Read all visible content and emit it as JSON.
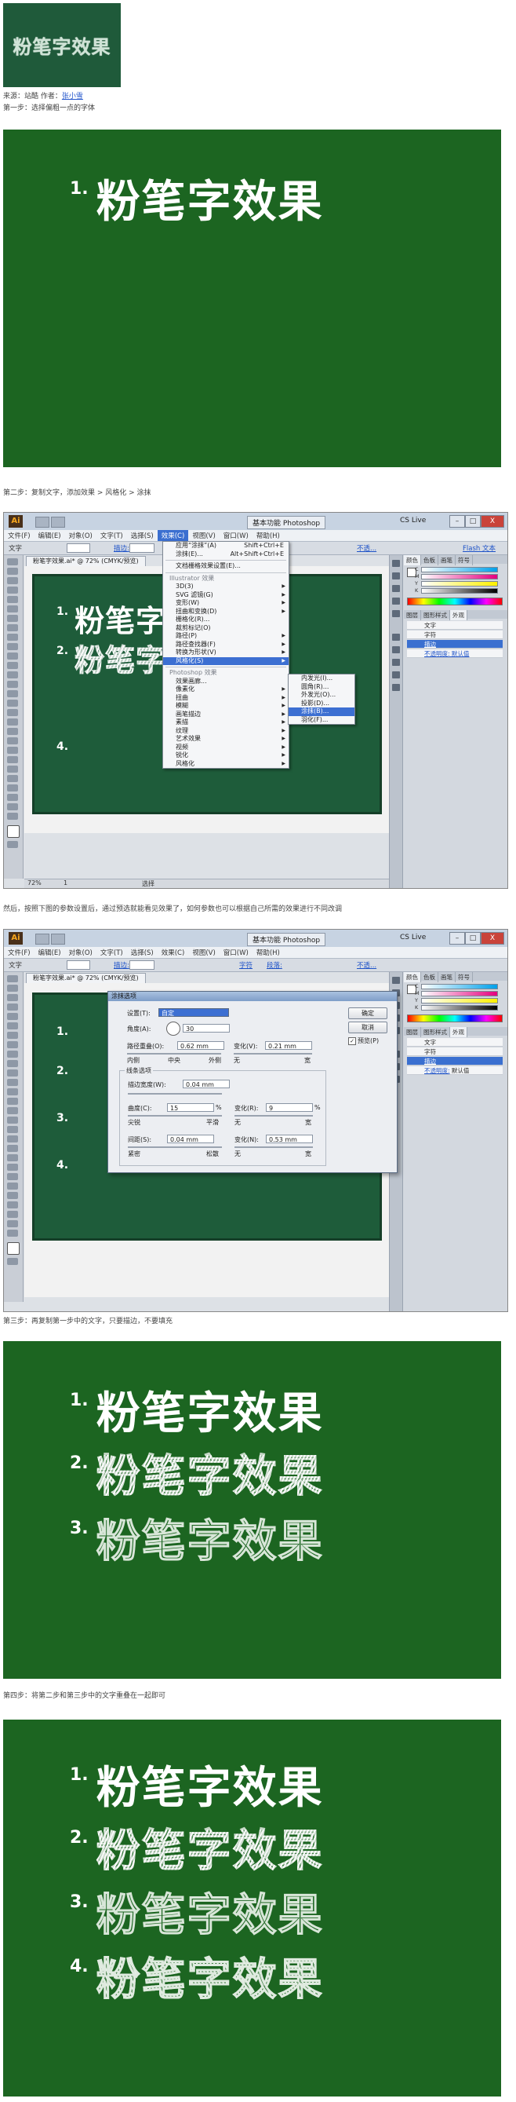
{
  "thumbnail": {
    "text": "粉笔字效果"
  },
  "source_line": {
    "prefix": "来源：站酷  作者：",
    "author": "张小雪"
  },
  "steps": [
    "第一步：选择偏粗一点的字体",
    "第二步：复制文字，添加效果 > 风格化 > 涂抹",
    "然后，按照下图的参数设置后，通过预选就能看见效果了，如何参数也可以根据自己所需的效果进行不同改调",
    "第三步：再复制第一步中的文字，只要描边，不要填充",
    "第四步：将第二步和第三步中的文字重叠在一起即可"
  ],
  "headline": "粉笔字效果",
  "numbers": [
    "1.",
    "2.",
    "3.",
    "4."
  ],
  "colors": {
    "board": "#1c6521",
    "artboard": "#1e5c3a",
    "accent": "#3c6fd2"
  },
  "illustrator": {
    "logo": "Ai",
    "workspace": "基本功能 Photoshop",
    "cs_live": "CS Live",
    "win_buttons": [
      "–",
      "□",
      "X"
    ],
    "menu": [
      "文件(F)",
      "编辑(E)",
      "对象(O)",
      "文字(T)",
      "选择(S)",
      "效果(C)",
      "视图(V)",
      "窗口(W)",
      "帮助(H)"
    ],
    "ctrl1": {
      "label": "文字",
      "stroke": "描边:",
      "style": "不透...",
      "char": "字符",
      "para": "段落:",
      "flash": "Flash 文本"
    },
    "ctrl2": {
      "label": "文字",
      "stroke": "描边:",
      "char": "字符",
      "para": "段落:",
      "style": "不透..."
    },
    "doc_tab": "粉笔字效果.ai* @ 72% (CMYK/预览)",
    "zoom": "72%",
    "status_select": "选择",
    "page": "1",
    "panel_tabs_top": [
      "颜色",
      "色板",
      "画笔",
      "符号"
    ],
    "panel_tabs_bottom": [
      "图层",
      "图形样式",
      "外观"
    ],
    "color_letters": [
      "C",
      "M",
      "Y",
      "K"
    ],
    "appearance_items": [
      "文字",
      "字符",
      "描边",
      "不透明度: 默认值"
    ],
    "appearance_items_2": [
      "文字",
      "字符",
      "描边",
      "不透明度:"
    ],
    "appearance_default": "默认值"
  },
  "effect_menu": {
    "items": [
      {
        "label": "应用“涂抹”(A)",
        "shortcut": "Shift+Ctrl+E"
      },
      {
        "label": "涂抹(E)...",
        "shortcut": "Alt+Shift+Ctrl+E"
      },
      {
        "label": "文档栅格效果设置(E)..."
      },
      {
        "label": "Illustrator 效果",
        "head": true
      },
      {
        "label": "3D(3)"
      },
      {
        "label": "SVG 滤镜(G)"
      },
      {
        "label": "变形(W)"
      },
      {
        "label": "扭曲和变换(D)"
      },
      {
        "label": "栅格化(R)..."
      },
      {
        "label": "裁剪标记(O)"
      },
      {
        "label": "路径(P)"
      },
      {
        "label": "路径查找器(F)"
      },
      {
        "label": "转换为形状(V)"
      },
      {
        "label": "风格化(S)",
        "hl": true
      },
      {
        "label": "Photoshop 效果",
        "head": true
      },
      {
        "label": "效果画廊..."
      },
      {
        "label": "像素化"
      },
      {
        "label": "扭曲"
      },
      {
        "label": "模糊"
      },
      {
        "label": "画笔描边"
      },
      {
        "label": "素描"
      },
      {
        "label": "纹理"
      },
      {
        "label": "艺术效果"
      },
      {
        "label": "视频"
      },
      {
        "label": "锐化"
      },
      {
        "label": "风格化"
      }
    ],
    "submenu": [
      "内发光(I)...",
      "圆角(R)...",
      "外发光(O)...",
      "投影(D)...",
      "涂抹(B)...",
      "羽化(F)..."
    ]
  },
  "scribble_dialog": {
    "title": "涂抹选项",
    "settings_label": "设置(T):",
    "settings_value": "自定",
    "angle_label": "角度(A):",
    "angle_value": "30",
    "path_overlap_label": "路径重叠(O):",
    "path_overlap_value": "0.62 mm",
    "variation_label": "变化(V):",
    "variation_value": "0.21 mm",
    "inside": "内侧",
    "center": "中央",
    "outside": "外侧",
    "none": "无",
    "wide": "宽",
    "line_options": "线条选项",
    "stroke_width_label": "描边宽度(W):",
    "stroke_width_value": "0.04 mm",
    "curviness_label": "曲度(C):",
    "curviness_value": "15",
    "curviness_var_label": "变化(R):",
    "curviness_var_value": "9",
    "pct": "%",
    "angular": "尖锐",
    "loopy": "平滑",
    "spacing_label": "间距(S):",
    "spacing_value": "0.04 mm",
    "spacing_var_label": "变化(N):",
    "spacing_var_value": "0.53 mm",
    "tight": "紧密",
    "loose": "松散",
    "ok": "确定",
    "cancel": "取消",
    "preview": "预览(P)"
  }
}
